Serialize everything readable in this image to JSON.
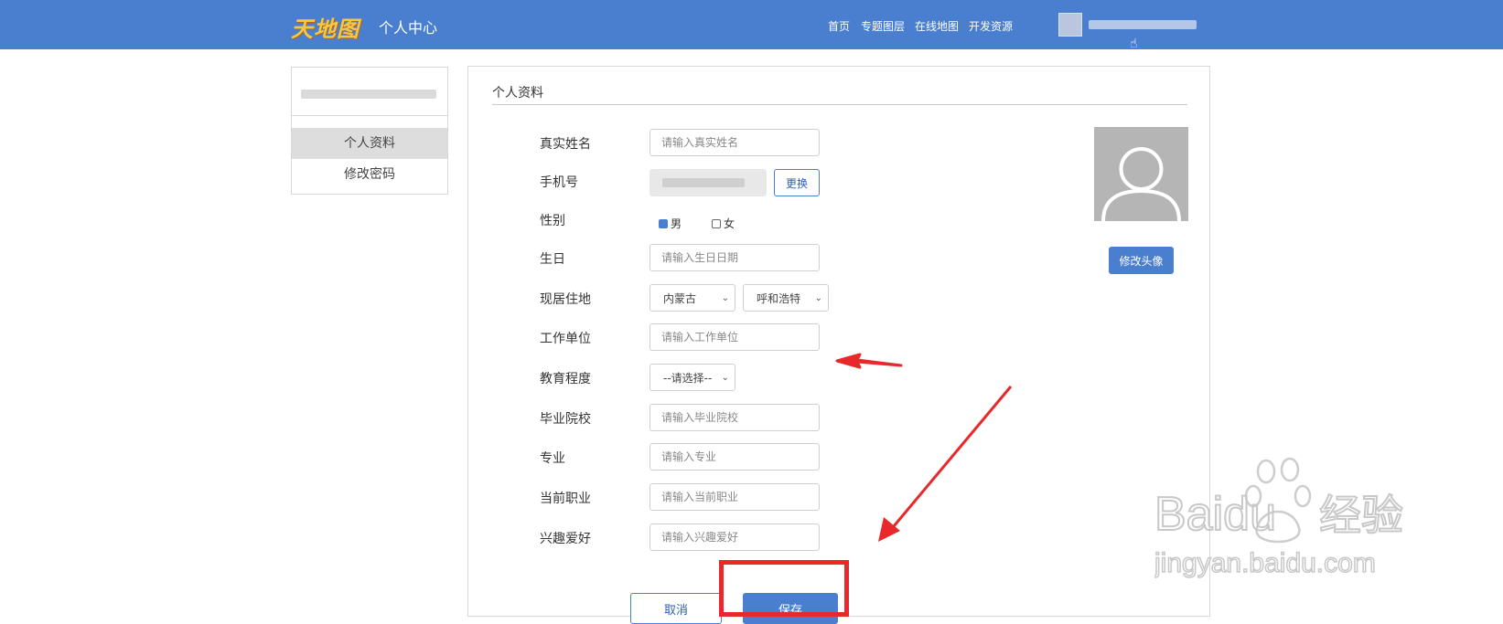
{
  "header": {
    "logo_text": "天地图",
    "app_title": "个人中心",
    "nav": [
      "首页",
      "专题图层",
      "在线地图",
      "开发资源"
    ],
    "bg_color": "#4a7fd0"
  },
  "sidebar": {
    "items": [
      {
        "label": "个人资料",
        "active": true
      },
      {
        "label": "修改密码",
        "active": false
      }
    ]
  },
  "panel": {
    "title": "个人资料",
    "fields": {
      "real_name": {
        "label": "真实姓名",
        "placeholder": "请输入真实姓名"
      },
      "phone": {
        "label": "手机号",
        "change_label": "更换"
      },
      "gender": {
        "label": "性别",
        "options": [
          {
            "label": "男",
            "checked": true
          },
          {
            "label": "女",
            "checked": false
          }
        ]
      },
      "birthday": {
        "label": "生日",
        "placeholder": "请输入生日日期"
      },
      "residence": {
        "label": "现居住地",
        "province": "内蒙古",
        "city": "呼和浩特"
      },
      "workplace": {
        "label": "工作单位",
        "placeholder": "请输入工作单位"
      },
      "education": {
        "label": "教育程度",
        "value": "--请选择--"
      },
      "school": {
        "label": "毕业院校",
        "placeholder": "请输入毕业院校"
      },
      "major": {
        "label": "专业",
        "placeholder": "请输入专业"
      },
      "job": {
        "label": "当前职业",
        "placeholder": "请输入当前职业"
      },
      "hobby": {
        "label": "兴趣爱好",
        "placeholder": "请输入兴趣爱好"
      }
    },
    "avatar_button": "修改头像",
    "cancel_label": "取消",
    "save_label": "保存"
  },
  "watermark": {
    "brand": "Baidu",
    "brand_cn": "经验",
    "url": "jingyan.baidu.com"
  },
  "annotation_color": "#e8282a"
}
